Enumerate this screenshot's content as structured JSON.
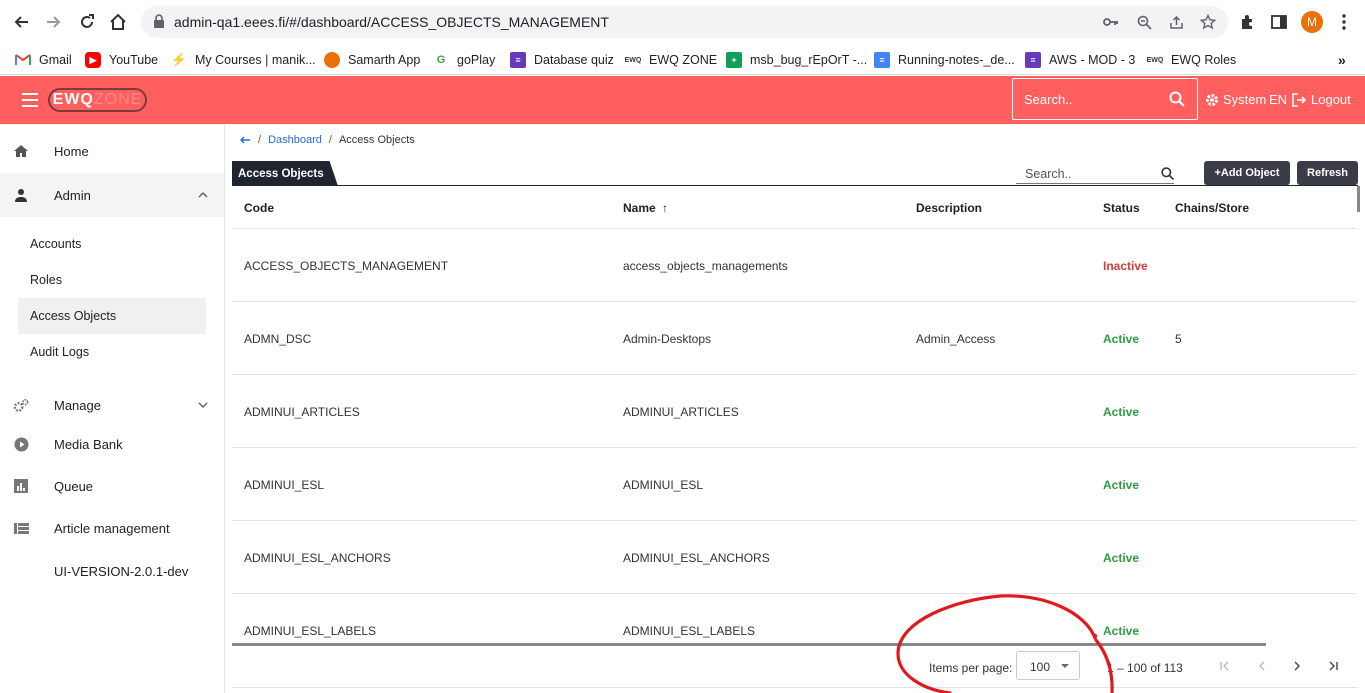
{
  "browser": {
    "url": "admin-qa1.eees.fi/#/dashboard/ACCESS_OBJECTS_MANAGEMENT",
    "profile_initial": "M",
    "bookmarks": [
      {
        "label": "Gmail",
        "icon": "gmail-icon"
      },
      {
        "label": "YouTube",
        "icon": "youtube-icon"
      },
      {
        "label": "My Courses | manik...",
        "icon": "courses-icon"
      },
      {
        "label": "Samarth App",
        "icon": "samarth-icon"
      },
      {
        "label": "goPlay",
        "icon": "goplay-icon"
      },
      {
        "label": "Database quiz",
        "icon": "forms-icon"
      },
      {
        "label": "EWQ ZONE",
        "icon": "ewq-icon"
      },
      {
        "label": "msb_bug_rEpOrT -...",
        "icon": "sheets-icon"
      },
      {
        "label": "Running-notes-_de...",
        "icon": "docs-icon"
      },
      {
        "label": "AWS - MOD - 3",
        "icon": "forms-icon"
      },
      {
        "label": "EWQ Roles",
        "icon": "ewq-icon"
      }
    ]
  },
  "header": {
    "logo_left": "EWQ",
    "logo_right": "ZONE",
    "search_placeholder": "Search..",
    "system_label": "System",
    "lang_label": "EN",
    "logout_label": "Logout"
  },
  "sidebar": {
    "home": "Home",
    "admin": "Admin",
    "admin_items": [
      "Accounts",
      "Roles",
      "Access Objects",
      "Audit Logs"
    ],
    "manage": "Manage",
    "media_bank": "Media Bank",
    "queue": "Queue",
    "article_management": "Article management",
    "version": "UI-VERSION-2.0.1-dev"
  },
  "breadcrumb": {
    "dashboard": "Dashboard",
    "current": "Access Objects"
  },
  "panel": {
    "title": "Access Objects",
    "search_placeholder": "Search..",
    "add_button": "+Add Object",
    "refresh_button": "Refresh"
  },
  "table": {
    "headers": {
      "code": "Code",
      "name": "Name",
      "sort": "↑",
      "description": "Description",
      "status": "Status",
      "chains": "Chains/Store"
    },
    "rows": [
      {
        "code": "ACCESS_OBJECTS_MANAGEMENT",
        "name": "access_objects_managements",
        "description": "",
        "status": "Inactive",
        "chains": ""
      },
      {
        "code": "ADMN_DSC",
        "name": "Admin-Desktops",
        "description": "Admin_Access",
        "status": "Active",
        "chains": "5"
      },
      {
        "code": "ADMINUI_ARTICLES",
        "name": "ADMINUI_ARTICLES",
        "description": "",
        "status": "Active",
        "chains": ""
      },
      {
        "code": "ADMINUI_ESL",
        "name": "ADMINUI_ESL",
        "description": "",
        "status": "Active",
        "chains": ""
      },
      {
        "code": "ADMINUI_ESL_ANCHORS",
        "name": "ADMINUI_ESL_ANCHORS",
        "description": "",
        "status": "Active",
        "chains": ""
      },
      {
        "code": "ADMINUI_ESL_LABELS",
        "name": "ADMINUI_ESL_LABELS",
        "description": "",
        "status": "Active",
        "chains": ""
      }
    ]
  },
  "paginator": {
    "items_per_page_label": "Items per page:",
    "items_per_page_value": "100",
    "range": "1 – 100 of 113"
  },
  "colors": {
    "header_bg": "#ff5f5f",
    "active": "#2e9d42",
    "inactive": "#d63a3a",
    "link": "#1e6fd9",
    "annotation": "#e0191e"
  }
}
